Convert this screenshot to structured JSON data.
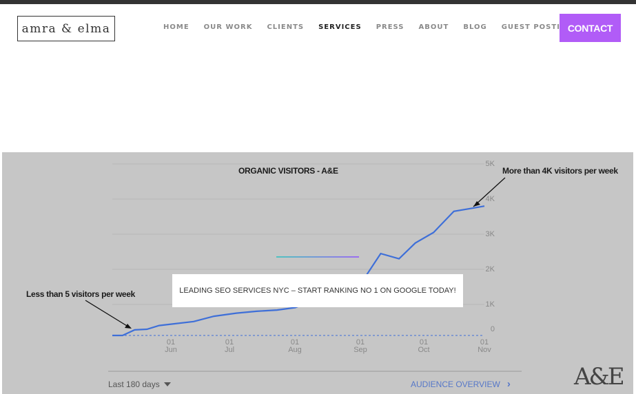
{
  "header": {
    "logo_text": "amra & elma",
    "nav": [
      "HOME",
      "OUR WORK",
      "CLIENTS",
      "SERVICES",
      "PRESS",
      "ABOUT",
      "BLOG",
      "GUEST POSTING"
    ],
    "active_nav": "SERVICES",
    "contact_label": "CONTACT",
    "accent_color": "#b15cf7"
  },
  "hero": {
    "banner_text": "LEADING SEO SERVICES NYC – START RANKING NO 1 ON GOOGLE TODAY!",
    "annotation_right": "More than 4K visitors per week",
    "annotation_left": "Less than 5 visitors per week",
    "range_select": "Last 180 days",
    "audience_link": "AUDIENCE OVERVIEW",
    "brand_mark": "A&E"
  },
  "chart_data": {
    "type": "line",
    "title": "ORGANIC VISITORS - A&E",
    "y_ticks": [
      "5K",
      "4K",
      "3K",
      "2K",
      "1K",
      "0"
    ],
    "x_ticks": [
      {
        "day": "01",
        "month": "Jun"
      },
      {
        "day": "01",
        "month": "Jul"
      },
      {
        "day": "01",
        "month": "Aug"
      },
      {
        "day": "01",
        "month": "Sep"
      },
      {
        "day": "01",
        "month": "Oct"
      },
      {
        "day": "01",
        "month": "Nov"
      }
    ],
    "ylim": [
      0,
      5000
    ],
    "series": [
      {
        "color": "#3e6fd8",
        "x": [
          "05-05",
          "05-10",
          "05-16",
          "05-22",
          "05-28",
          "06-05",
          "06-14",
          "06-24",
          "07-05",
          "07-15",
          "07-25",
          "08-03",
          "08-20",
          "09-01",
          "09-06",
          "09-14",
          "09-23",
          "10-01",
          "10-10",
          "10-20",
          "10-30",
          "11-04"
        ],
        "values": [
          0,
          0,
          180,
          200,
          320,
          380,
          450,
          620,
          720,
          780,
          820,
          900,
          1300,
          1800,
          1750,
          2450,
          2300,
          2750,
          3050,
          3650,
          3750,
          3800
        ]
      }
    ],
    "grid": true
  }
}
